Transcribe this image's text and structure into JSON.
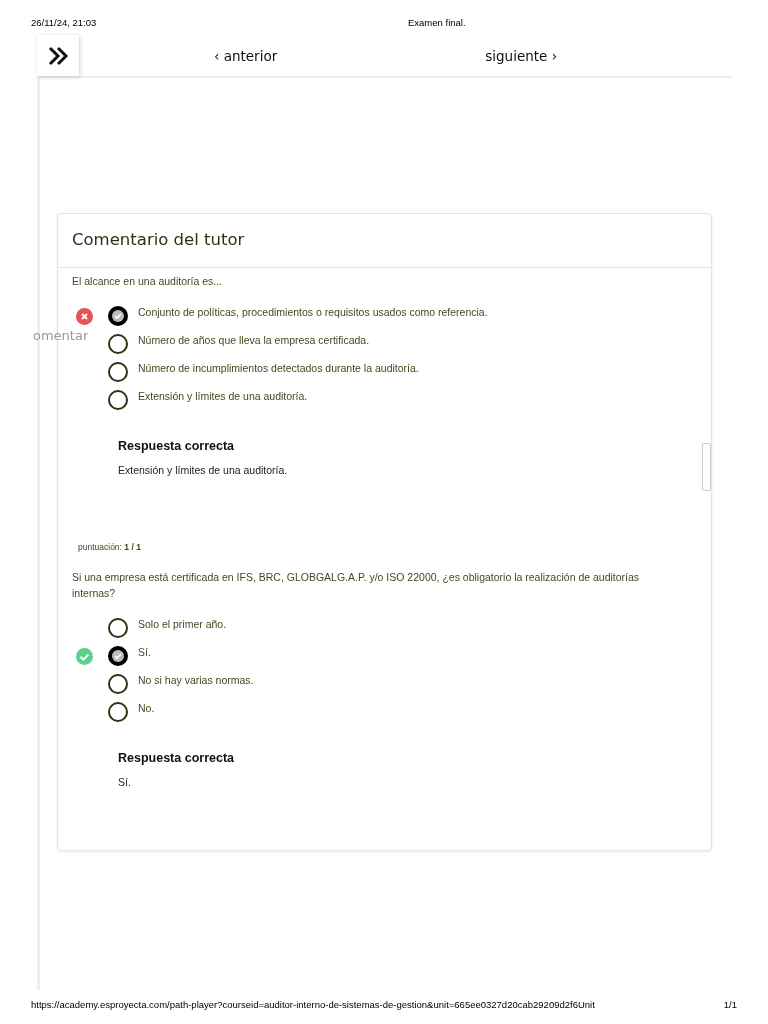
{
  "print_header": {
    "date": "26/11/24, 21:03",
    "title": "Examen final."
  },
  "nav": {
    "previous": "‹ anterior",
    "next": "siguiente ›"
  },
  "side_label": "omentar",
  "card": {
    "title": "Comentario del tutor",
    "questions": [
      {
        "text": "El alcance en una auditoría es...",
        "options": [
          {
            "label": "Conjunto de políticas, procedimientos o requisitos usados como referencia.",
            "selected": true,
            "correct": false
          },
          {
            "label": "Número de años que lleva la empresa certificada.",
            "selected": false
          },
          {
            "label": "Número de incumplimientos detectados durante la auditoría.",
            "selected": false
          },
          {
            "label": "Extensión y límites de una auditoría.",
            "selected": false
          }
        ],
        "answer_heading": "Respuesta correcta",
        "answer": "Extensión y límites de una auditoría."
      },
      {
        "score": "puntuación: **1 / 1**",
        "text": "Si una empresa está certificada en IFS, BRC, GLOBGALG.A.P. y/o ISO 22000, ¿es obligatorio la realización de auditorías internas?",
        "options": [
          {
            "label": "Solo el primer año.",
            "selected": false
          },
          {
            "label": "Sí.",
            "selected": true,
            "correct": true
          },
          {
            "label": "No si hay varias normas.",
            "selected": false
          },
          {
            "label": "No.",
            "selected": false
          }
        ],
        "answer_heading": "Respuesta correcta",
        "answer": "Sí."
      }
    ]
  },
  "print_footer": {
    "url": "https://academy.esproyecta.com/path-player?courseid=auditor-interno-de-sistemas-de-gestion&unit=665ee0327d20cab29209d2f6Unit",
    "page": "1/1"
  }
}
